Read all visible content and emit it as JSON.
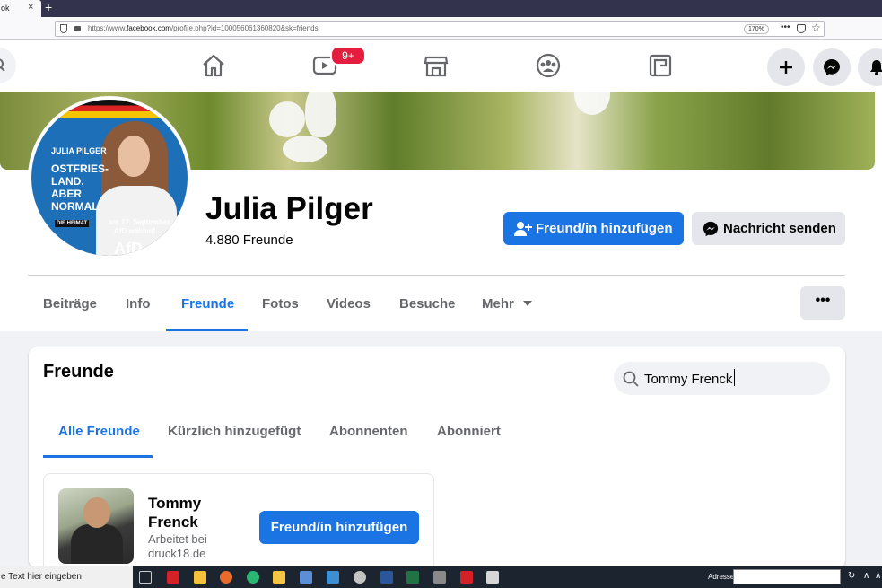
{
  "browser": {
    "tab_title": "ok",
    "tab_close": "×",
    "new_tab": "+",
    "url_prefix": "https://www.",
    "url_domain": "facebook.com",
    "url_rest": "/profile.php?id=100056061360820&sk=friends",
    "zoom": "170%",
    "more": "•••",
    "star": "☆"
  },
  "header": {
    "notification_badge": "9+"
  },
  "profile": {
    "name": "Julia Pilger",
    "friends_count": "4.880 Freunde",
    "add_friend_label": "Freund/in hinzufügen",
    "message_label": "Nachricht senden",
    "avatar_text": {
      "line1": "JULIA PILGER",
      "line2": "OSTFRIES-",
      "line3": "LAND.",
      "line4": "ABER",
      "line5": "NORMAL.",
      "line6": "am 12. September",
      "line7": "AfD wählen!",
      "badge": "DIE HEIMAT",
      "bottom": "AfD"
    },
    "tabs": [
      {
        "label": "Beiträge"
      },
      {
        "label": "Info"
      },
      {
        "label": "Freunde"
      },
      {
        "label": "Fotos"
      },
      {
        "label": "Videos"
      },
      {
        "label": "Besuche"
      },
      {
        "label": "Mehr"
      }
    ],
    "more_label": "•••"
  },
  "friends": {
    "title": "Freunde",
    "search_value": "Tommy Frenck",
    "tabs": [
      {
        "label": "Alle Freunde"
      },
      {
        "label": "Kürzlich hinzugefügt"
      },
      {
        "label": "Abonnenten"
      },
      {
        "label": "Abonniert"
      }
    ],
    "results": [
      {
        "name": "Tommy Frenck",
        "subtitle": "Arbeitet bei druck18.de",
        "add_label": "Freund/in hinzufügen"
      }
    ]
  },
  "taskbar": {
    "search_placeholder": "e Text hier eingeben",
    "address_label": "Adresse"
  },
  "colors": {
    "accent": "#1b74e4",
    "badge": "#e41e3f",
    "secondary_btn": "#e4e6eb"
  }
}
